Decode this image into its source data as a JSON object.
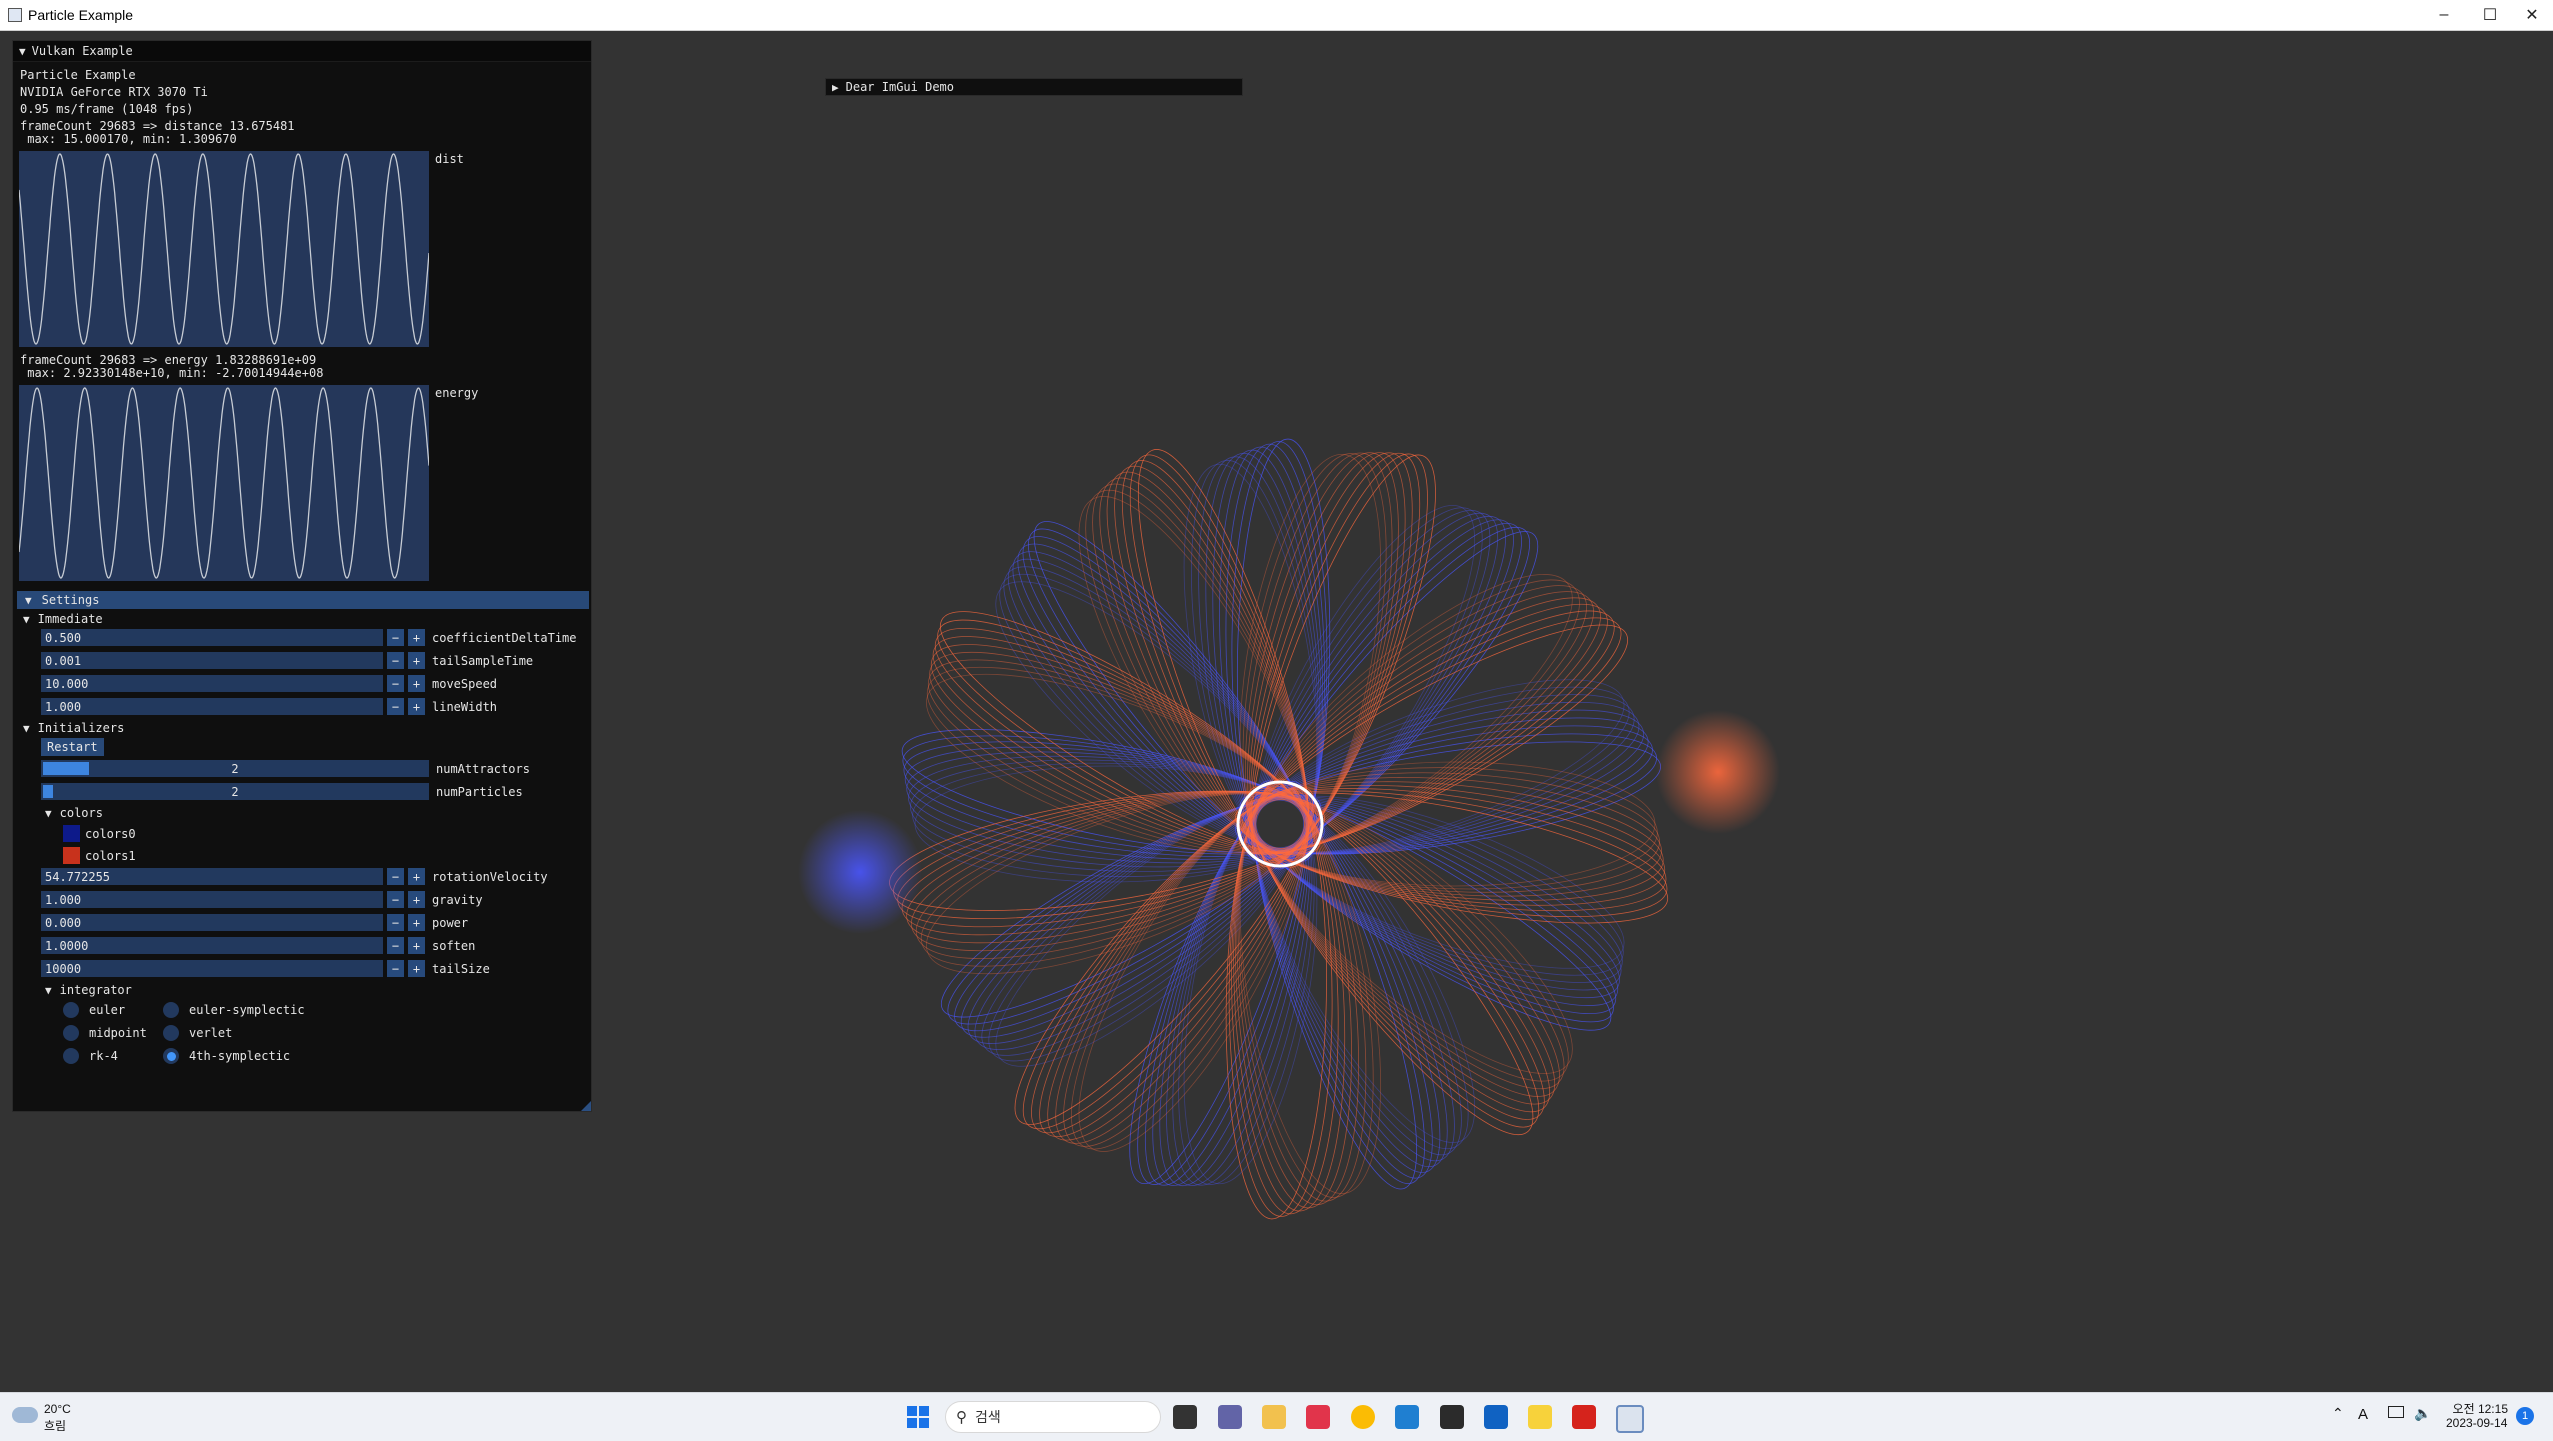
{
  "window": {
    "title": "Particle Example",
    "minimize_icon": "minimize-icon",
    "maximize_icon": "maximize-icon",
    "close_icon": "close-icon"
  },
  "panel": {
    "title": "Vulkan Example",
    "app_name": "Particle Example",
    "gpu": "NVIDIA GeForce RTX 3070 Ti",
    "frame_time": "0.95 ms/frame (1048 fps)",
    "dist_line1": "frameCount 29683 => distance 13.675481",
    "dist_line2": " max: 15.000170, min: 1.309670",
    "dist_label": "dist",
    "energy_line1": "frameCount 29683 => energy 1.83288691e+09",
    "energy_line2": " max: 2.92330148e+10, min: -2.70014944e+08",
    "energy_label": "energy",
    "settings_label": "Settings",
    "immediate_label": "Immediate",
    "immediate": [
      {
        "value": "0.500",
        "label": "coefficientDeltaTime"
      },
      {
        "value": "0.001",
        "label": "tailSampleTime"
      },
      {
        "value": "10.000",
        "label": "moveSpeed"
      },
      {
        "value": "1.000",
        "label": "lineWidth"
      }
    ],
    "minus": "−",
    "plus": "+",
    "initializers_label": "Initializers",
    "restart_label": "Restart",
    "num_attractors": {
      "value": "2",
      "label": "numAttractors",
      "fraction": 0.12
    },
    "num_particles": {
      "value": "2",
      "label": "numParticles",
      "fraction": 0.02
    },
    "colors_label": "colors",
    "colors": [
      {
        "label": "colors0",
        "color": "#0d1a8a"
      },
      {
        "label": "colors1",
        "color": "#c8321c"
      }
    ],
    "params": [
      {
        "value": "54.772255",
        "label": "rotationVelocity"
      },
      {
        "value": "1.000",
        "label": "gravity"
      },
      {
        "value": "0.000",
        "label": "power"
      },
      {
        "value": "1.0000",
        "label": "soften"
      },
      {
        "value": "10000",
        "label": "tailSize"
      }
    ],
    "integrator_label": "integrator",
    "integrators": [
      {
        "label": "euler",
        "selected": false
      },
      {
        "label": "euler-symplectic",
        "selected": false
      },
      {
        "label": "midpoint",
        "selected": false
      },
      {
        "label": "verlet",
        "selected": false
      },
      {
        "label": "rk-4",
        "selected": false
      },
      {
        "label": "4th-symplectic",
        "selected": true
      }
    ]
  },
  "demo_window": {
    "title": "Dear ImGui Demo"
  },
  "scene": {
    "orange": "#ff6a3d",
    "blue": "#4a56ff",
    "background": "#333333"
  },
  "taskbar": {
    "weather_temp": "20°C",
    "weather_desc": "흐림",
    "search_placeholder": "검색",
    "time": "오전 12:15",
    "date": "2023-09-14",
    "notification_count": "1",
    "ime_label": "A",
    "apps": [
      "start-icon",
      "search-icon",
      "task-view-icon",
      "chat-icon",
      "file-explorer-icon",
      "snipping-tool-icon",
      "chrome-icon",
      "vscode-icon",
      "terminal-icon",
      "mail-icon",
      "notes-icon",
      "acrobat-icon",
      "vulkan-app-icon"
    ]
  }
}
